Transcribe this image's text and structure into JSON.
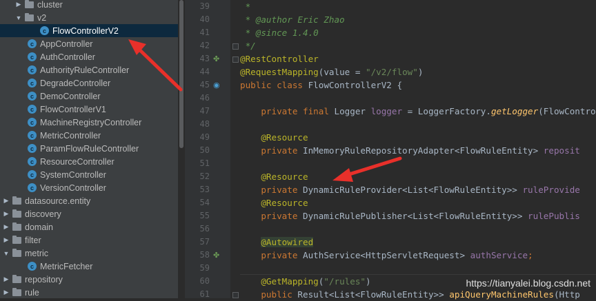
{
  "tree": {
    "items": [
      {
        "label": "cluster",
        "type": "folder",
        "indent": 1,
        "expanded": false
      },
      {
        "label": "v2",
        "type": "folder",
        "indent": 1,
        "expanded": true
      },
      {
        "label": "FlowControllerV2",
        "type": "class",
        "indent": 3,
        "selected": true
      },
      {
        "label": "AppController",
        "type": "class",
        "indent": 2
      },
      {
        "label": "AuthController",
        "type": "class",
        "indent": 2
      },
      {
        "label": "AuthorityRuleController",
        "type": "class",
        "indent": 2
      },
      {
        "label": "DegradeController",
        "type": "class",
        "indent": 2
      },
      {
        "label": "DemoController",
        "type": "class",
        "indent": 2
      },
      {
        "label": "FlowControllerV1",
        "type": "class",
        "indent": 2
      },
      {
        "label": "MachineRegistryController",
        "type": "class",
        "indent": 2
      },
      {
        "label": "MetricController",
        "type": "class",
        "indent": 2
      },
      {
        "label": "ParamFlowRuleController",
        "type": "class",
        "indent": 2
      },
      {
        "label": "ResourceController",
        "type": "class",
        "indent": 2
      },
      {
        "label": "SystemController",
        "type": "class",
        "indent": 2
      },
      {
        "label": "VersionController",
        "type": "class",
        "indent": 2
      },
      {
        "label": "datasource.entity",
        "type": "folder",
        "indent": 0,
        "expanded": false
      },
      {
        "label": "discovery",
        "type": "folder",
        "indent": 0,
        "expanded": false
      },
      {
        "label": "domain",
        "type": "folder",
        "indent": 0,
        "expanded": false
      },
      {
        "label": "filter",
        "type": "folder",
        "indent": 0,
        "expanded": false
      },
      {
        "label": "metric",
        "type": "folder",
        "indent": 0,
        "expanded": true
      },
      {
        "label": "MetricFetcher",
        "type": "class",
        "indent": 2
      },
      {
        "label": "repository",
        "type": "folder",
        "indent": 0,
        "expanded": false
      },
      {
        "label": "rule",
        "type": "folder",
        "indent": 0,
        "expanded": false
      }
    ]
  },
  "editor": {
    "lines": [
      {
        "n": "39",
        "tokens": [
          {
            "t": " *",
            "c": "cm"
          }
        ]
      },
      {
        "n": "40",
        "tokens": [
          {
            "t": " * @author Eric Zhao",
            "c": "cm"
          }
        ]
      },
      {
        "n": "41",
        "tokens": [
          {
            "t": " * @since 1.4.0",
            "c": "cm"
          }
        ]
      },
      {
        "n": "42",
        "tokens": [
          {
            "t": " */",
            "c": "cm"
          }
        ],
        "fold": true
      },
      {
        "n": "43",
        "tokens": [
          {
            "t": "@RestController",
            "c": "an"
          }
        ],
        "fold": true,
        "gutter": "bean-icon"
      },
      {
        "n": "44",
        "tokens": [
          {
            "t": "@RequestMapping",
            "c": "an"
          },
          {
            "t": "(",
            "c": ""
          },
          {
            "t": "value",
            "c": ""
          },
          {
            "t": " = ",
            "c": ""
          },
          {
            "t": "\"/v2/flow\"",
            "c": "st"
          },
          {
            "t": ")",
            "c": ""
          }
        ]
      },
      {
        "n": "45",
        "tokens": [
          {
            "t": "public class ",
            "c": "kw"
          },
          {
            "t": "FlowControllerV2 {",
            "c": ""
          }
        ],
        "gutter": "bean-class-icon"
      },
      {
        "n": "46",
        "tokens": []
      },
      {
        "n": "47",
        "tokens": [
          {
            "t": "    private final ",
            "c": "kw"
          },
          {
            "t": "Logger ",
            "c": ""
          },
          {
            "t": "logger",
            "c": "fld"
          },
          {
            "t": " = LoggerFactory.",
            "c": ""
          },
          {
            "t": "getLogger",
            "c": "mth"
          },
          {
            "t": "(FlowContro",
            "c": ""
          }
        ]
      },
      {
        "n": "48",
        "tokens": []
      },
      {
        "n": "49",
        "tokens": [
          {
            "t": "    @Resource",
            "c": "an"
          }
        ]
      },
      {
        "n": "50",
        "tokens": [
          {
            "t": "    private ",
            "c": "kw"
          },
          {
            "t": "InMemoryRuleRepositoryAdapter<FlowRuleEntity> ",
            "c": ""
          },
          {
            "t": "reposit",
            "c": "fld"
          }
        ]
      },
      {
        "n": "51",
        "tokens": []
      },
      {
        "n": "52",
        "tokens": [
          {
            "t": "    @Resource",
            "c": "an"
          }
        ]
      },
      {
        "n": "53",
        "tokens": [
          {
            "t": "    private ",
            "c": "kw"
          },
          {
            "t": "DynamicRuleProvider<List<FlowRuleEntity>> ",
            "c": ""
          },
          {
            "t": "ruleProvide",
            "c": "fld"
          }
        ]
      },
      {
        "n": "54",
        "tokens": [
          {
            "t": "    @Resource",
            "c": "an"
          }
        ]
      },
      {
        "n": "55",
        "tokens": [
          {
            "t": "    private ",
            "c": "kw"
          },
          {
            "t": "DynamicRulePublisher<List<FlowRuleEntity>> ",
            "c": ""
          },
          {
            "t": "rulePublis",
            "c": "fld"
          }
        ]
      },
      {
        "n": "56",
        "tokens": []
      },
      {
        "n": "57",
        "tokens": [
          {
            "t": "    ",
            "c": ""
          },
          {
            "t": "@Autowired",
            "c": "an hl"
          }
        ]
      },
      {
        "n": "58",
        "tokens": [
          {
            "t": "    private ",
            "c": "kw"
          },
          {
            "t": "AuthService<HttpServletRequest> ",
            "c": ""
          },
          {
            "t": "authService",
            "c": "fld"
          },
          {
            "t": ";",
            "c": "kw"
          }
        ],
        "gutter": "bean-icon"
      },
      {
        "n": "59",
        "tokens": []
      },
      {
        "n": "60",
        "tokens": [
          {
            "t": "    @GetMapping",
            "c": "an"
          },
          {
            "t": "(",
            "c": ""
          },
          {
            "t": "\"/rules\"",
            "c": "st"
          },
          {
            "t": ")",
            "c": ""
          }
        ]
      },
      {
        "n": "61",
        "tokens": [
          {
            "t": "    public ",
            "c": "kw"
          },
          {
            "t": "Result<List<FlowRuleEntity>> ",
            "c": ""
          },
          {
            "t": "apiQueryMachineRules",
            "c": "mthb"
          },
          {
            "t": "(Http",
            "c": ""
          }
        ],
        "fold": true
      }
    ]
  },
  "watermark": "https://tianyalei.blog.csdn.net",
  "colors": {
    "arrow": "#e8302a",
    "selection": "#0d293e"
  }
}
